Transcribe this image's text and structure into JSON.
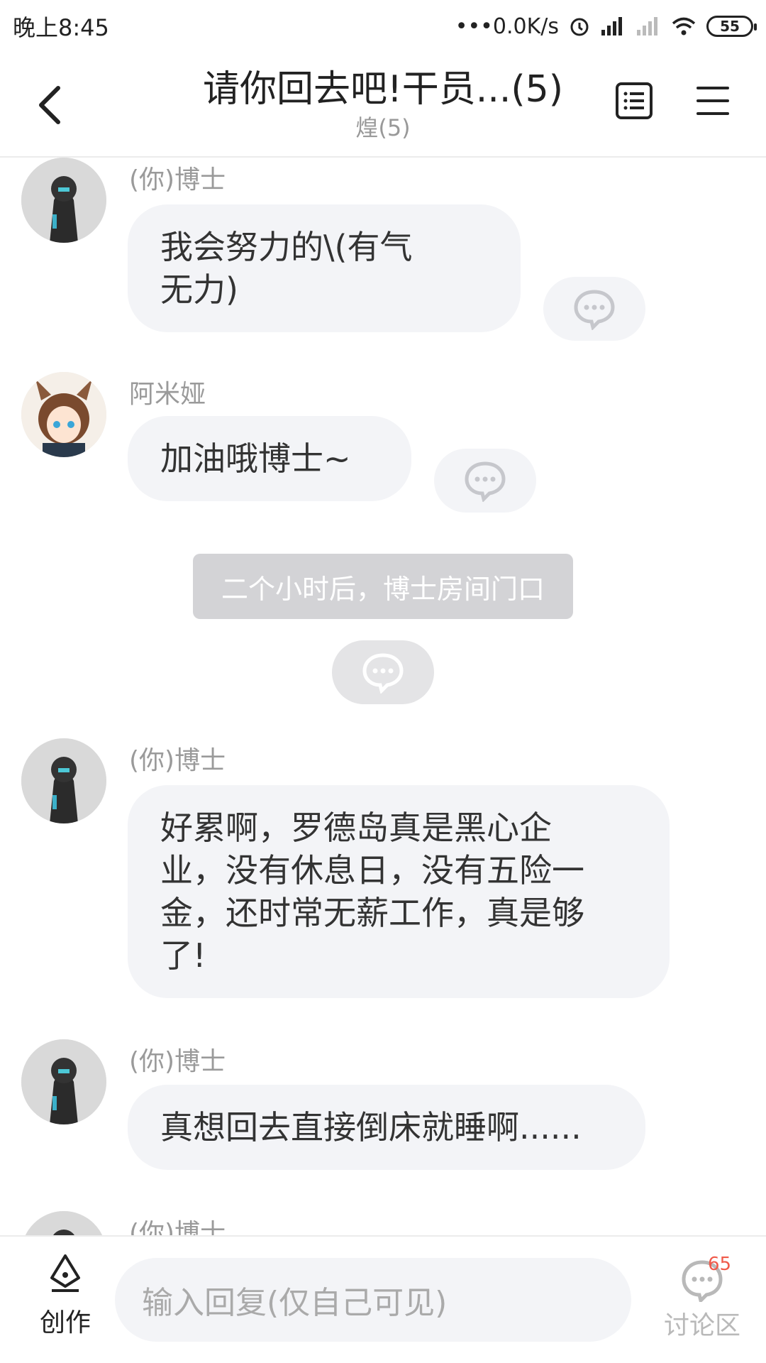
{
  "status_bar": {
    "time": "晚上8:45",
    "network_speed": "•••0.0K/s",
    "battery": "55"
  },
  "header": {
    "title": "请你回去吧!干员...(5)",
    "subtitle": "煌(5)"
  },
  "messages": [
    {
      "sender": "(你)博士",
      "text": "我会努力的\\(有气\n无力)",
      "avatar": "doctor"
    },
    {
      "sender": "阿米娅",
      "text": "加油哦博士~",
      "avatar": "amiya"
    },
    {
      "sender": "(你)博士",
      "text": "好累啊，罗德岛真是黑心企\n业，没有休息日，没有五险一\n金，还时常无薪工作，真是够\n了!",
      "avatar": "doctor"
    },
    {
      "sender": "(你)博士",
      "text": "真想回去直接倒床就睡啊......",
      "avatar": "doctor"
    },
    {
      "sender": "(你)博士",
      "text": "",
      "avatar": "doctor"
    }
  ],
  "narration": {
    "text": "二个小时后，博士房间门口"
  },
  "bottom_bar": {
    "create_label": "创作",
    "reply_placeholder": "输入回复(仅自己可见)",
    "discuss_label": "讨论区",
    "discuss_count": "65"
  },
  "colors": {
    "bubble": "#f3f4f7",
    "narration_bg": "#d3d3d6",
    "badge_red": "#f05a4a"
  }
}
